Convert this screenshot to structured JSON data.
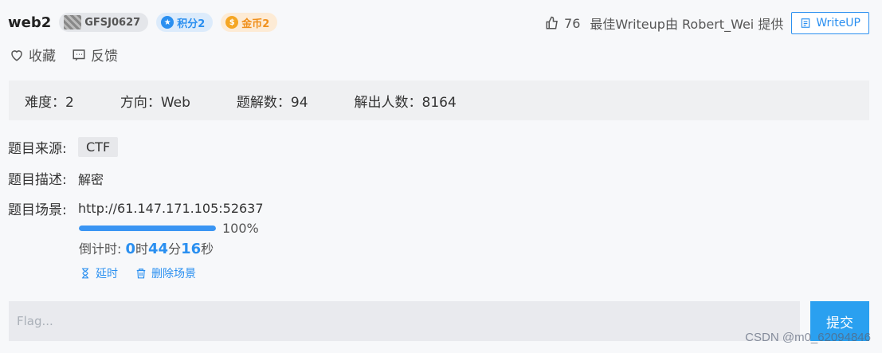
{
  "challenge": {
    "title": "web2",
    "user": "GFSJ0627",
    "score_label": "积分2",
    "coin_label": "金币2",
    "likes": "76",
    "best_writeup": "最佳Writeup由 Robert_Wei 提供",
    "writeup_button": "WriteUP"
  },
  "actions": {
    "favorite": "收藏",
    "feedback": "反馈"
  },
  "stats": {
    "difficulty": "难度：2",
    "direction": "方向：Web",
    "solves": "题解数：94",
    "solvers": "解出人数：8164"
  },
  "info": {
    "source_label": "题目来源:",
    "source_value": "CTF",
    "desc_label": "题目描述:",
    "desc_value": "解密",
    "scene_label": "题目场景:",
    "scene_value": "http://61.147.171.105:52637",
    "progress_fraction": 1.0,
    "progress_text": "100%",
    "countdown_prefix": "倒计时: ",
    "hours": "0",
    "hours_unit": "时",
    "minutes": "44",
    "minutes_unit": "分",
    "seconds": "16",
    "seconds_unit": "秒",
    "extend": "延时",
    "delete_scene": "删除场景"
  },
  "flag": {
    "placeholder": "Flag...",
    "submit": "提交"
  },
  "watermark": "CSDN @m0_62094846",
  "colors": {
    "accent": "#2a8ff0",
    "submit": "#2aa0f0",
    "coin": "#f0901c"
  }
}
